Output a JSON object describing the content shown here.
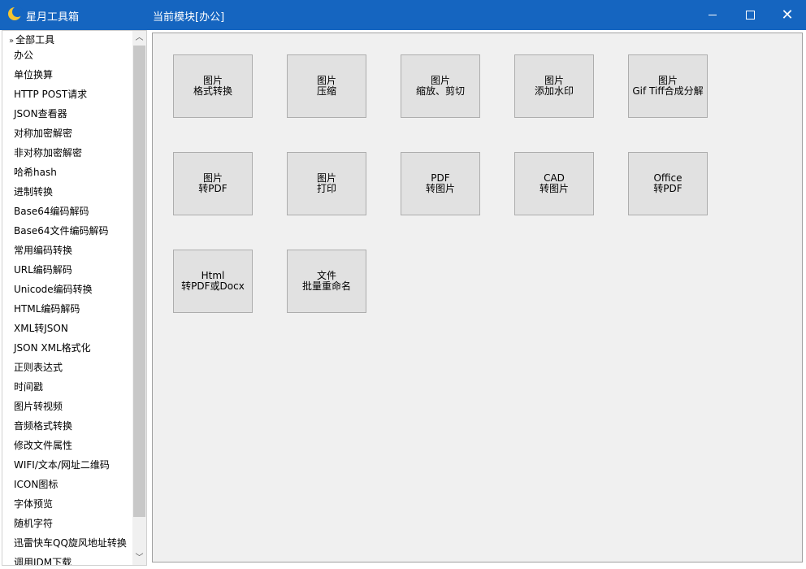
{
  "window": {
    "app_title": "星月工具箱",
    "module_title": "当前模块[办公]",
    "min_icon": "minimize-icon",
    "max_icon": "maximize-icon",
    "close_icon": "close-icon",
    "accent_color": "#1565c0"
  },
  "sidebar": {
    "root_label": "全部工具",
    "items": [
      "办公",
      "单位换算",
      "HTTP POST请求",
      "JSON查看器",
      "对称加密解密",
      "非对称加密解密",
      "哈希hash",
      "进制转换",
      "Base64编码解码",
      "Base64文件编码解码",
      "常用编码转换",
      "URL编码解码",
      "Unicode编码转换",
      "HTML编码解码",
      "XML转JSON",
      "JSON XML格式化",
      "正则表达式",
      "时间戳",
      "图片转视频",
      "音频格式转换",
      "修改文件属性",
      "WIFI/文本/网址二维码",
      "ICON图标",
      "字体预览",
      "随机字符",
      "迅雷快车QQ旋风地址转换",
      "调用IDM下载"
    ]
  },
  "tiles": [
    {
      "line1": "图片",
      "line2": "格式转换"
    },
    {
      "line1": "图片",
      "line2": "压缩"
    },
    {
      "line1": "图片",
      "line2": "缩放、剪切"
    },
    {
      "line1": "图片",
      "line2": "添加水印"
    },
    {
      "line1": "图片",
      "line2": "Gif Tiff合成分解"
    },
    {
      "line1": "图片",
      "line2": "转PDF"
    },
    {
      "line1": "图片",
      "line2": "打印"
    },
    {
      "line1": "PDF",
      "line2": "转图片"
    },
    {
      "line1": "CAD",
      "line2": "转图片"
    },
    {
      "line1": "Office",
      "line2": "转PDF"
    },
    {
      "line1": "Html",
      "line2": "转PDF或Docx"
    },
    {
      "line1": "文件",
      "line2": "批量重命名"
    }
  ]
}
